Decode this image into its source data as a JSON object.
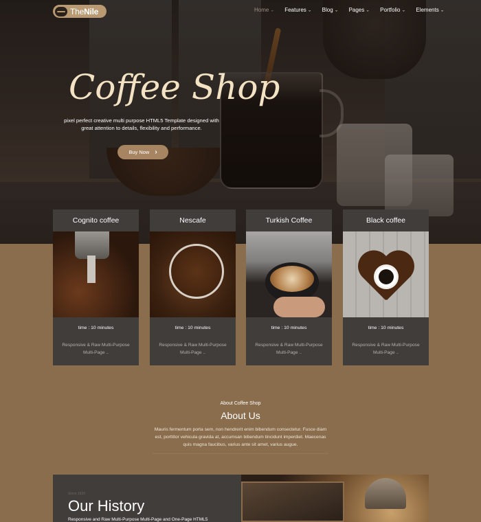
{
  "brand": {
    "logo_prefix": "The",
    "logo_name": "Nile"
  },
  "nav": {
    "items": [
      {
        "label": "Home",
        "active": true
      },
      {
        "label": "Features",
        "active": false
      },
      {
        "label": "Blog",
        "active": false
      },
      {
        "label": "Pages",
        "active": false
      },
      {
        "label": "Portfolio",
        "active": false
      },
      {
        "label": "Elements",
        "active": false
      }
    ]
  },
  "hero": {
    "title": "Coffee Shop",
    "subtitle": "pixel perfect creative multi purpose HTML5 Template designed with great attention to details, flexibility and performance.",
    "button_label": "Buy Now",
    "button_icon": "chevron-right-icon"
  },
  "cards": [
    {
      "title": "Cognito coffee",
      "time": "time : 10 minutes",
      "description": "Responsive & Raw Multi-Purpose Multi-Page ..",
      "image": "coffee-grinder-image"
    },
    {
      "title": "Nescafe",
      "time": "time : 10 minutes",
      "description": "Responsive & Raw Multi-Purpose Multi-Page ..",
      "image": "coffee-beans-plate-image"
    },
    {
      "title": "Turkish Coffee",
      "time": "time : 10 minutes",
      "description": "Responsive & Raw Multi-Purpose Multi-Page ..",
      "image": "latte-art-image"
    },
    {
      "title": "Black coffee",
      "time": "time : 10 minutes",
      "description": "Responsive & Raw Multi-Purpose Multi-Page ..",
      "image": "coffee-heart-image"
    }
  ],
  "about": {
    "kicker": "About Coffee Shop",
    "title": "About Us",
    "text": "Mauris fermentum porta sem, non hendrerit enim bibendum consectetur. Fusce diam est, porttitor vehicula gravida at, accumsan bibendum tincidunt imperdiet. Maecenas quis magna faucibus, varius ante sit amet, varius augue."
  },
  "history": {
    "kicker": "Since 1920",
    "title": "Our History",
    "text": "Responsive and Raw Multi-Purpose Multi-Page and One-Page HTML5"
  },
  "colors": {
    "page_bg": "#8a6d4d",
    "card_bg": "#403d3b",
    "accent": "#a88562",
    "hero_title": "#f3e3c4"
  }
}
